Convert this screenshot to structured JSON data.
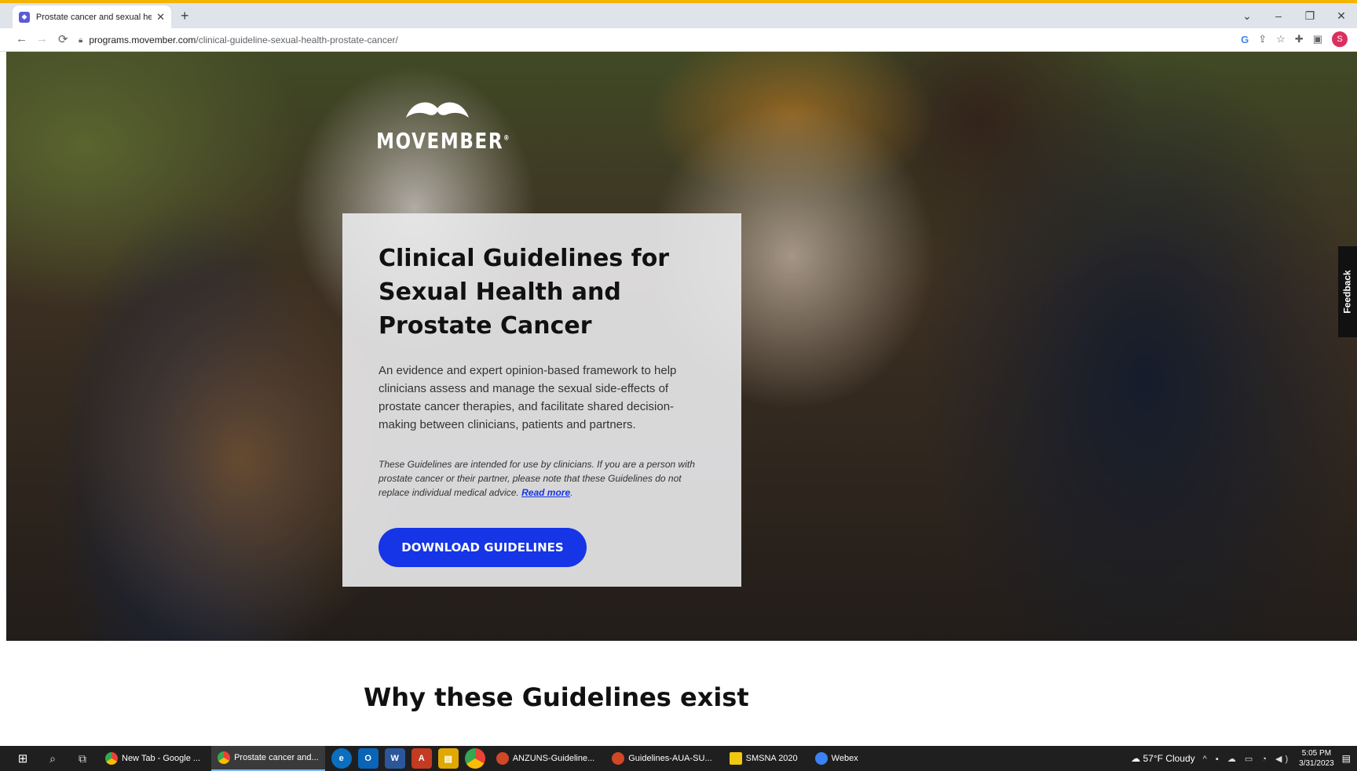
{
  "browser": {
    "tab_title": "Prostate cancer and sexual health",
    "new_tab_glyph": "+",
    "close_glyph": "✕",
    "url_host": "programs.movember.com",
    "url_path": "/clinical-guideline-sexual-health-prostate-cancer/",
    "profile_initial": "S"
  },
  "hero": {
    "logo_text": "MOVEMBER",
    "logo_mark": "®",
    "title": "Clinical Guidelines for Sexual Health and Prostate Cancer",
    "description": "An evidence and expert opinion-based framework to help clinicians assess and manage the sexual side-effects of prostate cancer therapies, and facilitate shared decision-making between clinicians, patients and partners.",
    "note": "These Guidelines are intended for use by clinicians. If you are a person with prostate cancer or their partner, please note that these Guidelines do not replace individual medical advice.",
    "read_more": "Read more",
    "note_period": ".",
    "download_label": "DOWNLOAD GUIDELINES",
    "feedback_label": "Feedback"
  },
  "section": {
    "title": "Why these Guidelines exist"
  },
  "taskbar": {
    "apps": [
      {
        "label": "New Tab - Google ...",
        "color": "#34a853",
        "active": false
      },
      {
        "label": "Prostate cancer and...",
        "color": "#34a853",
        "active": true
      }
    ],
    "pinned_apps": [
      {
        "label": "ANZUNS-Guideline...",
        "color": "#d24726"
      },
      {
        "label": "Guidelines-AUA-SU...",
        "color": "#d24726"
      },
      {
        "label": "SMSNA 2020",
        "color": "#f2c811"
      },
      {
        "label": "Webex",
        "color": "#3b82f6"
      }
    ],
    "weather": "57°F  Cloudy",
    "time": "5:05 PM",
    "date": "3/31/2023"
  },
  "colors": {
    "accent": "#1535e6",
    "tab_bar": "#dfe3ea",
    "taskbar": "#1f1f1f"
  }
}
